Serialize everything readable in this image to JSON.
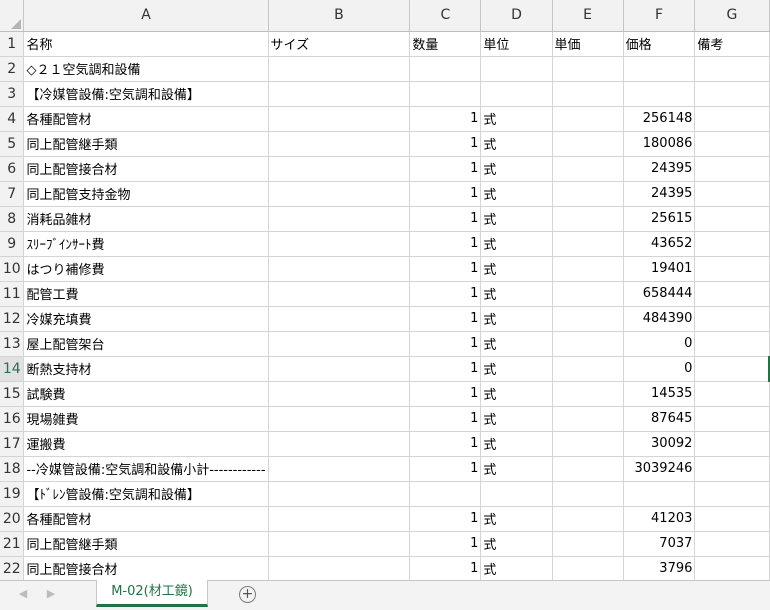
{
  "spreadsheet": {
    "column_headers": [
      "A",
      "B",
      "C",
      "D",
      "E",
      "F",
      "G"
    ],
    "rows": [
      {
        "num": "1",
        "cells": [
          "名称",
          "サイズ",
          "数量",
          "単位",
          "単価",
          "価格",
          "備考"
        ]
      },
      {
        "num": "2",
        "cells": [
          "◇２１空気調和設備",
          "",
          "",
          "",
          "",
          "",
          ""
        ]
      },
      {
        "num": "3",
        "cells": [
          "【冷媒管設備:空気調和設備】",
          "",
          "",
          "",
          "",
          "",
          ""
        ]
      },
      {
        "num": "4",
        "cells": [
          "各種配管材",
          "",
          "1",
          "式",
          "",
          "256148",
          ""
        ]
      },
      {
        "num": "5",
        "cells": [
          "同上配管継手類",
          "",
          "1",
          "式",
          "",
          "180086",
          ""
        ]
      },
      {
        "num": "6",
        "cells": [
          "同上配管接合材",
          "",
          "1",
          "式",
          "",
          "24395",
          ""
        ]
      },
      {
        "num": "7",
        "cells": [
          "同上配管支持金物",
          "",
          "1",
          "式",
          "",
          "24395",
          ""
        ]
      },
      {
        "num": "8",
        "cells": [
          "消耗品雑材",
          "",
          "1",
          "式",
          "",
          "25615",
          ""
        ]
      },
      {
        "num": "9",
        "cells": [
          "ｽﾘｰﾌﾞｲﾝｻｰﾄ費",
          "",
          "1",
          "式",
          "",
          "43652",
          ""
        ]
      },
      {
        "num": "10",
        "cells": [
          "はつり補修費",
          "",
          "1",
          "式",
          "",
          "19401",
          ""
        ]
      },
      {
        "num": "11",
        "cells": [
          "配管工費",
          "",
          "1",
          "式",
          "",
          "658444",
          ""
        ]
      },
      {
        "num": "12",
        "cells": [
          "冷媒充填費",
          "",
          "1",
          "式",
          "",
          "484390",
          ""
        ]
      },
      {
        "num": "13",
        "cells": [
          "屋上配管架台",
          "",
          "1",
          "式",
          "",
          "0",
          ""
        ]
      },
      {
        "num": "14",
        "cells": [
          "断熱支持材",
          "",
          "1",
          "式",
          "",
          "0",
          ""
        ]
      },
      {
        "num": "15",
        "cells": [
          "試験費",
          "",
          "1",
          "式",
          "",
          "14535",
          ""
        ]
      },
      {
        "num": "16",
        "cells": [
          "現場雑費",
          "",
          "1",
          "式",
          "",
          "87645",
          ""
        ]
      },
      {
        "num": "17",
        "cells": [
          "運搬費",
          "",
          "1",
          "式",
          "",
          "30092",
          ""
        ]
      },
      {
        "num": "18",
        "cells": [
          "--冷媒管設備:空気調和設備小計------------",
          "",
          "1",
          "式",
          "",
          "3039246",
          ""
        ]
      },
      {
        "num": "19",
        "cells": [
          "【ﾄﾞﾚﾝ管設備:空気調和設備】",
          "",
          "",
          "",
          "",
          "",
          ""
        ]
      },
      {
        "num": "20",
        "cells": [
          "各種配管材",
          "",
          "1",
          "式",
          "",
          "41203",
          ""
        ]
      },
      {
        "num": "21",
        "cells": [
          "同上配管継手類",
          "",
          "1",
          "式",
          "",
          "7037",
          ""
        ]
      },
      {
        "num": "22",
        "cells": [
          "同上配管接合材",
          "",
          "1",
          "式",
          "",
          "3796",
          ""
        ]
      }
    ],
    "selected_row": "14"
  },
  "tabs": {
    "active_sheet": "M-02(材工鏡)",
    "add_sheet_icon": "plus-circle-icon",
    "nav_prev_icon": "triangle-left-icon",
    "nav_next_icon": "triangle-right-icon",
    "nav_prev_glyph": "◀",
    "nav_next_glyph": "▶",
    "add_glyph": "+"
  },
  "colors": {
    "accent": "#217346",
    "header_bg": "#f2f2f2",
    "gridline": "#d4d4d4"
  }
}
